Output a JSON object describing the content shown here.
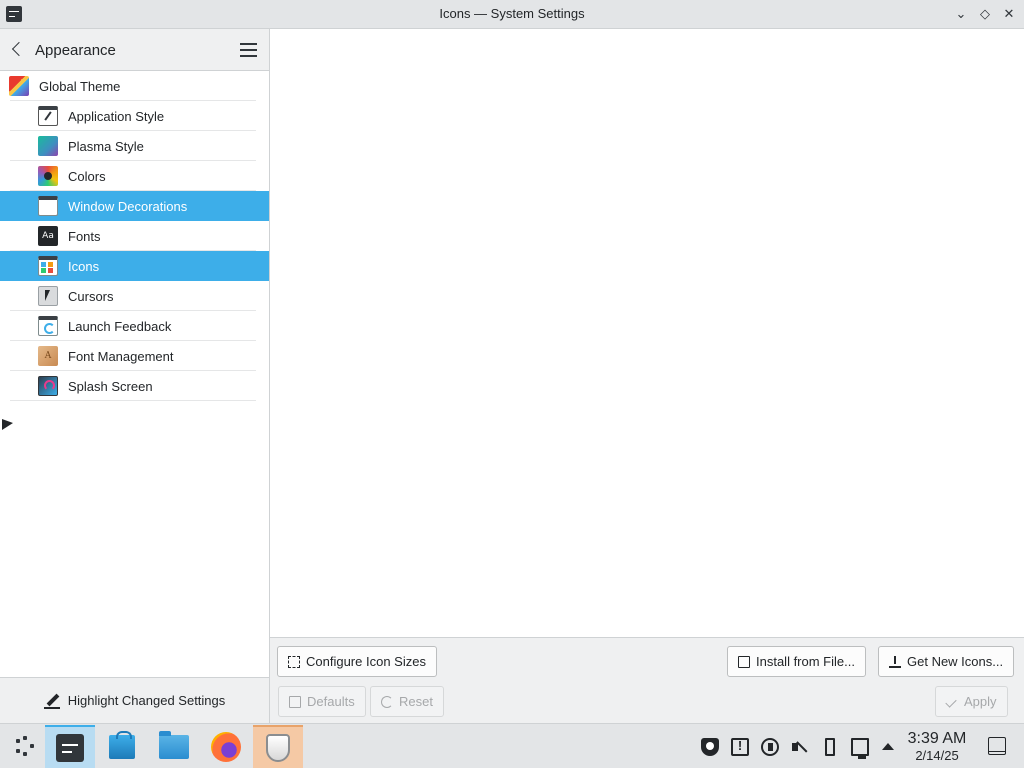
{
  "window": {
    "title": "Icons — System Settings",
    "controls": {
      "minimize": "⌄",
      "maximize": "◇",
      "close": "✕"
    }
  },
  "sidebar": {
    "heading": "Appearance",
    "items": [
      {
        "label": "Global Theme",
        "icon": "global-theme-icon",
        "selected": false
      },
      {
        "label": "Application Style",
        "icon": "application-style-icon",
        "selected": false
      },
      {
        "label": "Plasma Style",
        "icon": "plasma-style-icon",
        "selected": false
      },
      {
        "label": "Colors",
        "icon": "colors-icon",
        "selected": false
      },
      {
        "label": "Window Decorations",
        "icon": "window-decorations-icon",
        "selected": true
      },
      {
        "label": "Fonts",
        "icon": "fonts-icon",
        "selected": false
      },
      {
        "label": "Icons",
        "icon": "icons-icon",
        "selected": true
      },
      {
        "label": "Cursors",
        "icon": "cursors-icon",
        "selected": false
      },
      {
        "label": "Launch Feedback",
        "icon": "launch-feedback-icon",
        "selected": false
      },
      {
        "label": "Font Management",
        "icon": "font-management-icon",
        "selected": false
      },
      {
        "label": "Splash Screen",
        "icon": "splash-screen-icon",
        "selected": false
      }
    ],
    "fonts_glyph": "Aa",
    "fontmgmt_glyph": "A",
    "footer_label": "Highlight Changed Settings"
  },
  "main": {
    "buttons": {
      "configure_sizes": "Configure Icon Sizes",
      "install_from_file": "Install from File...",
      "get_new": "Get New Icons...",
      "defaults": "Defaults",
      "reset": "Reset",
      "apply": "Apply"
    }
  },
  "taskbar": {
    "apps": [
      "application-launcher-icon",
      "system-settings-icon",
      "discover-store-icon",
      "file-manager-icon",
      "firefox-icon",
      "shield-app-icon"
    ],
    "tray": [
      "shield-tray-icon",
      "clipboard-alert-icon",
      "updates-icon",
      "volume-muted-icon",
      "usb-device-icon",
      "network-icon",
      "expand-tray-icon"
    ],
    "clock": {
      "time": "3:39 AM",
      "date": "2/14/25"
    }
  },
  "colors": {
    "accent": "#3daee9",
    "selection_text": "#ffffff",
    "panel_bg": "#eff0f1",
    "content_bg": "#ffffff"
  }
}
